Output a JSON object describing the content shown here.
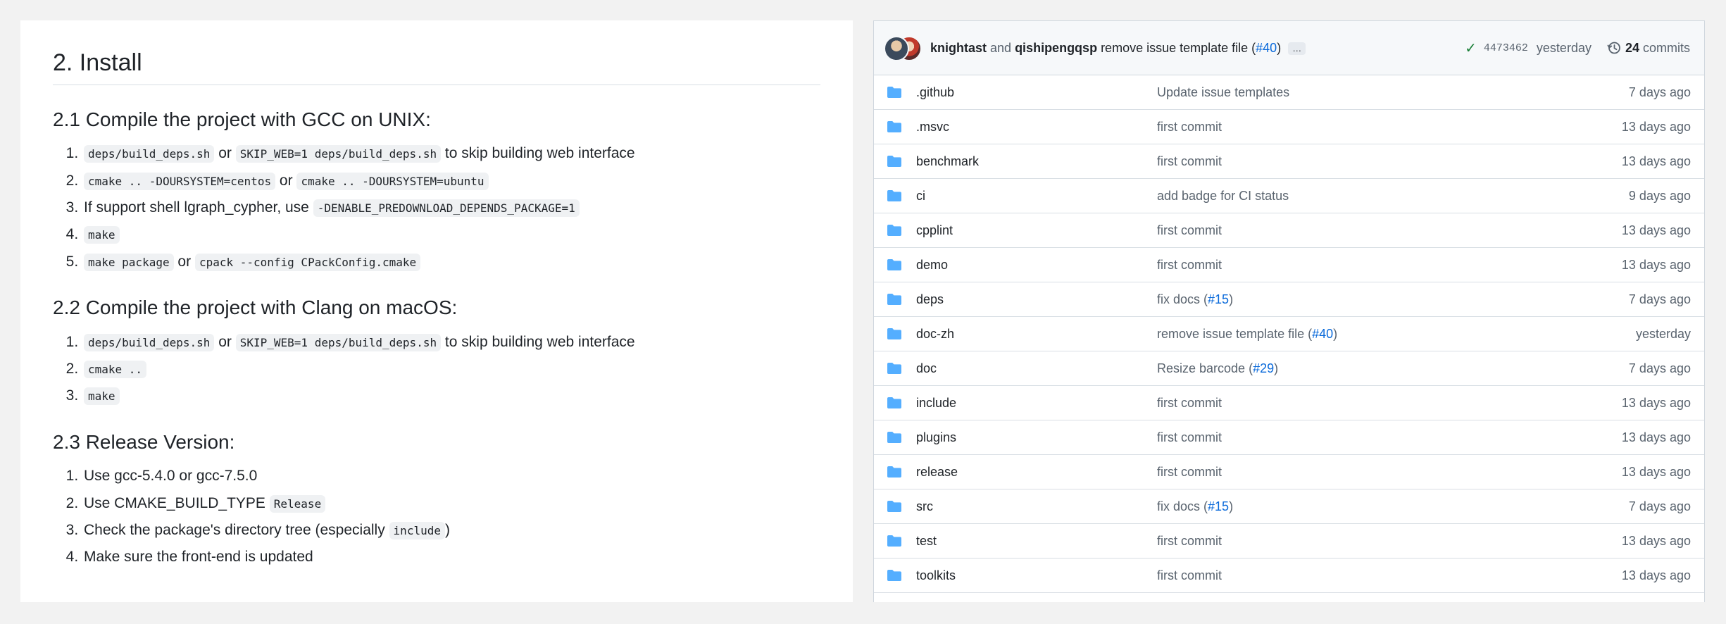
{
  "readme": {
    "install_heading": "2. Install",
    "sections": [
      {
        "title": "2.1 Compile the project with GCC on UNIX:",
        "items": [
          [
            {
              "code": "deps/build_deps.sh"
            },
            {
              "text": " or "
            },
            {
              "code": "SKIP_WEB=1 deps/build_deps.sh"
            },
            {
              "text": " to skip building web interface"
            }
          ],
          [
            {
              "code": "cmake .. -DOURSYSTEM=centos"
            },
            {
              "text": " or "
            },
            {
              "code": "cmake .. -DOURSYSTEM=ubuntu"
            }
          ],
          [
            {
              "text": "If support shell lgraph_cypher, use "
            },
            {
              "code": "-DENABLE_PREDOWNLOAD_DEPENDS_PACKAGE=1"
            }
          ],
          [
            {
              "code": "make"
            }
          ],
          [
            {
              "code": "make package"
            },
            {
              "text": " or "
            },
            {
              "code": "cpack --config CPackConfig.cmake"
            }
          ]
        ]
      },
      {
        "title": "2.2 Compile the project with Clang on macOS:",
        "items": [
          [
            {
              "code": "deps/build_deps.sh"
            },
            {
              "text": " or "
            },
            {
              "code": "SKIP_WEB=1 deps/build_deps.sh"
            },
            {
              "text": " to skip building web interface"
            }
          ],
          [
            {
              "code": "cmake .."
            }
          ],
          [
            {
              "code": "make"
            }
          ]
        ]
      },
      {
        "title": "2.3 Release Version:",
        "items": [
          [
            {
              "text": "Use gcc-5.4.0 or gcc-7.5.0"
            }
          ],
          [
            {
              "text": "Use CMAKE_BUILD_TYPE "
            },
            {
              "code": "Release"
            }
          ],
          [
            {
              "text": "Check the package's directory tree (especially "
            },
            {
              "code": "include"
            },
            {
              "text": ")"
            }
          ],
          [
            {
              "text": "Make sure the front-end is updated"
            }
          ]
        ]
      }
    ]
  },
  "browser": {
    "commit": {
      "author1": "knightast",
      "and": " and ",
      "author2": "qishipengqsp",
      "message": " remove issue template file (",
      "pr": "#40",
      "message_end": ")",
      "ellipsis": "…",
      "sha": "4473462",
      "when": "yesterday",
      "commits_count": "24",
      "commits_label": "commits"
    },
    "files": [
      {
        "name": ".github",
        "message": "Update issue templates",
        "age": "7 days ago"
      },
      {
        "name": ".msvc",
        "message": "first commit",
        "age": "13 days ago"
      },
      {
        "name": "benchmark",
        "message": "first commit",
        "age": "13 days ago"
      },
      {
        "name": "ci",
        "message": "add badge for CI status",
        "age": "9 days ago"
      },
      {
        "name": "cpplint",
        "message": "first commit",
        "age": "13 days ago"
      },
      {
        "name": "demo",
        "message": "first commit",
        "age": "13 days ago"
      },
      {
        "name": "deps",
        "message": "fix docs (",
        "link": "#15",
        "message_end": ")",
        "age": "7 days ago"
      },
      {
        "name": "doc-zh",
        "message": "remove issue template file (",
        "link": "#40",
        "message_end": ")",
        "age": "yesterday"
      },
      {
        "name": "doc",
        "message": "Resize barcode (",
        "link": "#29",
        "message_end": ")",
        "age": "7 days ago"
      },
      {
        "name": "include",
        "message": "first commit",
        "age": "13 days ago"
      },
      {
        "name": "plugins",
        "message": "first commit",
        "age": "13 days ago"
      },
      {
        "name": "release",
        "message": "first commit",
        "age": "13 days ago"
      },
      {
        "name": "src",
        "message": "fix docs (",
        "link": "#15",
        "message_end": ")",
        "age": "7 days ago"
      },
      {
        "name": "test",
        "message": "first commit",
        "age": "13 days ago"
      },
      {
        "name": "toolkits",
        "message": "first commit",
        "age": "13 days ago"
      }
    ],
    "colors": {
      "folder": "#54aeff",
      "link": "#0969da",
      "check": "#1a7f37"
    }
  }
}
